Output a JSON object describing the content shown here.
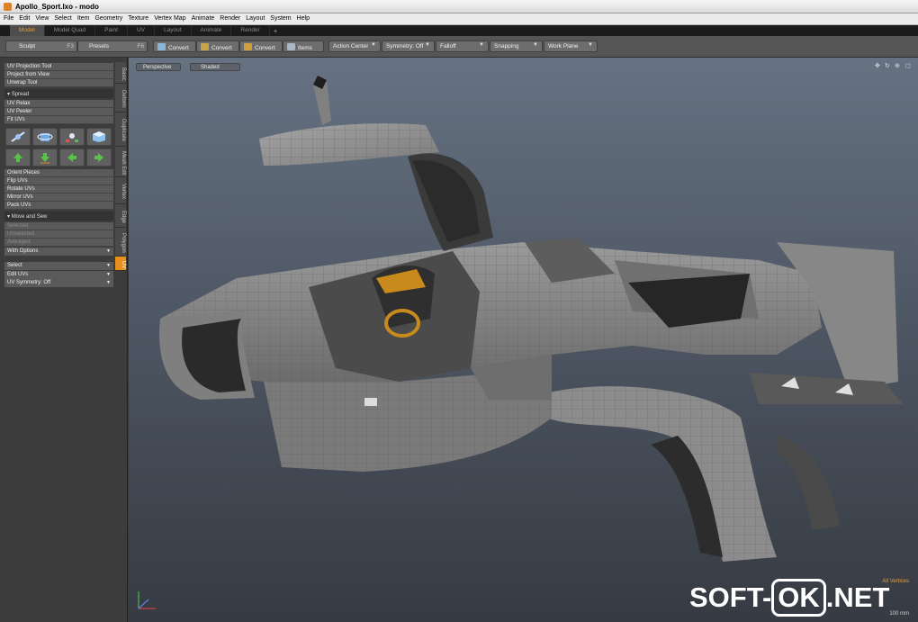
{
  "window": {
    "title": "Apollo_Sport.lxo - modo"
  },
  "menu": [
    "File",
    "Edit",
    "View",
    "Select",
    "Item",
    "Geometry",
    "Texture",
    "Vertex Map",
    "Animate",
    "Render",
    "Layout",
    "System",
    "Help"
  ],
  "layout_tabs": {
    "items": [
      "Model",
      "Model Quad",
      "Paint",
      "UV",
      "Layout",
      "Animate",
      "Render"
    ],
    "active": "Model",
    "add": "+"
  },
  "toolbar": {
    "sculpt": "Sculpt",
    "sculpt_key": "F3",
    "presets": "Presets",
    "presets_key": "F6",
    "convert1": "Convert",
    "convert2": "Convert",
    "convert3": "Convert",
    "items": "Items",
    "action_center": "Action Center",
    "symmetry": "Symmetry: Off",
    "falloff": "Falloff",
    "snapping": "Snapping",
    "work_plane": "Work Plane"
  },
  "panel": {
    "uv_projection": "UV Projection Tool",
    "project_from_view": "Project from View",
    "unwrap": "Unwrap Tool",
    "spread": "Spread",
    "uv_relax": "UV Relax",
    "uv_peeler": "UV Peeler",
    "fit_uvs": "Fit UVs",
    "orient": "Orient Pieces",
    "flip": "Flip UVs",
    "rotate": "Rotate UVs",
    "mirror": "Mirror UVs",
    "pack": "Pack UVs",
    "move_sew": "Move and Sew",
    "selected": "Selected",
    "unselected": "Unselected",
    "averaged": "Averaged",
    "with_options": "With Options",
    "select": "Select",
    "edit_uvs": "Edit UVs",
    "uv_symmetry": "UV Symmetry: Off"
  },
  "side_tabs": [
    "Basic",
    "Deform",
    "Duplicate",
    "Mesh Edit",
    "Vertex",
    "Edge",
    "Polygon",
    "UV"
  ],
  "side_tab_active": "UV",
  "viewport": {
    "view": "Perspective",
    "shading": "Shaded",
    "info_mode": "All Vertices",
    "info_scale": "100 mm"
  },
  "watermark": {
    "left": "SOFT-",
    "mid": "OK",
    "right": ".NET"
  },
  "colors": {
    "accent": "#e7901d",
    "viewport_top": "#667282",
    "viewport_bottom": "#363b43"
  }
}
